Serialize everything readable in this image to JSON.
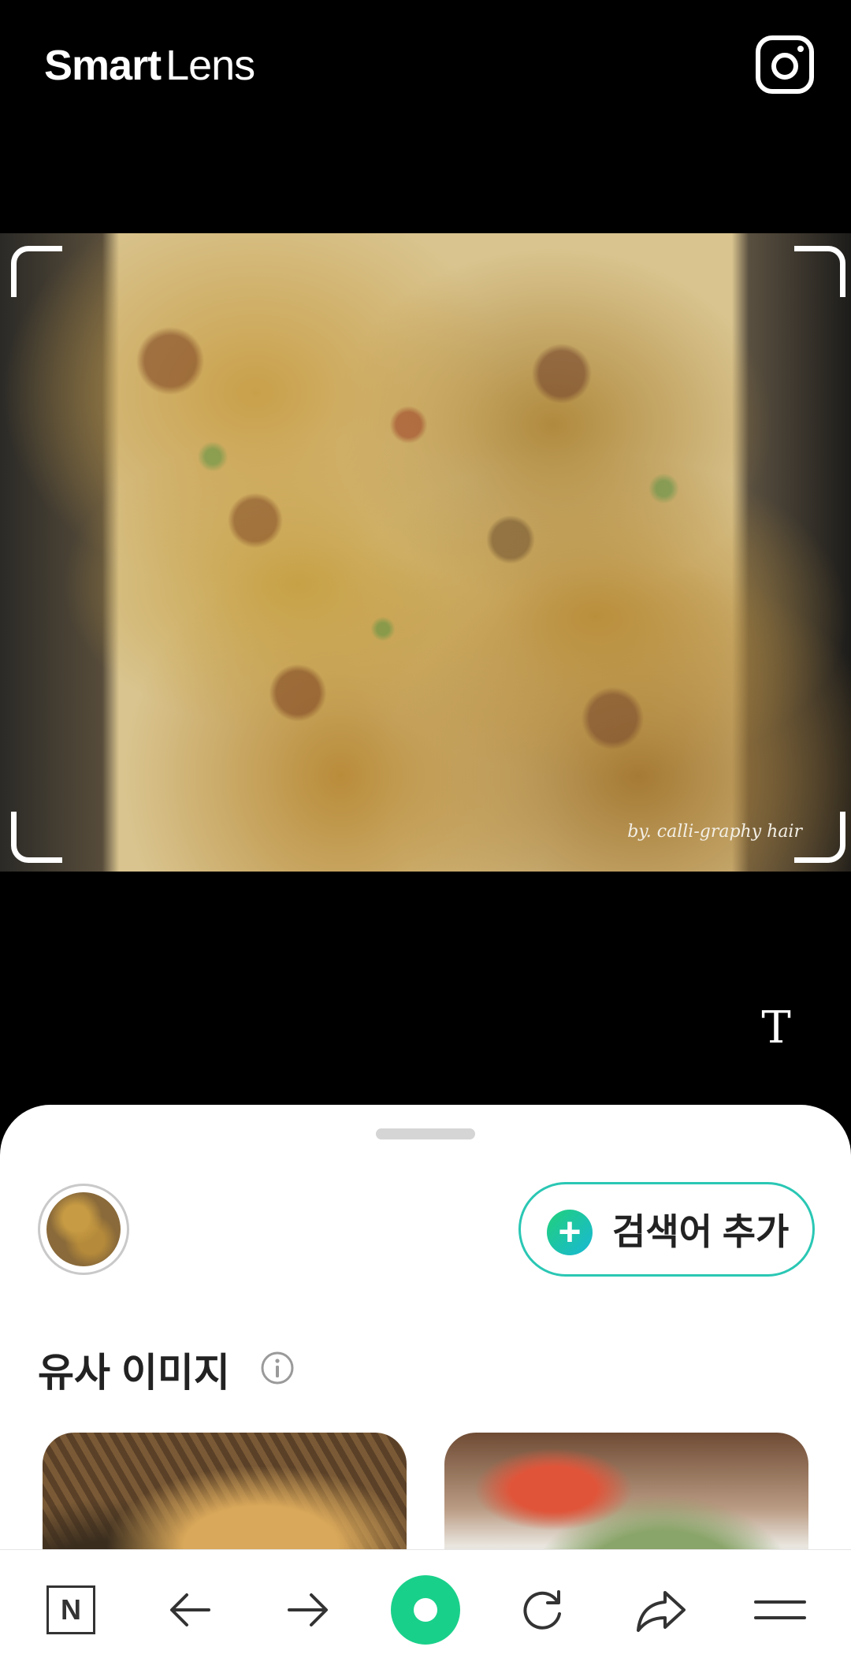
{
  "app": {
    "brand_bold": "Smart",
    "brand_light": "Lens"
  },
  "header": {
    "camera_icon": "camera-icon"
  },
  "photo": {
    "watermark": "by. calli-graphy hair"
  },
  "text_mode": {
    "label": "T"
  },
  "sheet": {
    "add_keyword_label": "검색어 추가",
    "add_icon_glyph": "+",
    "similar_images_title": "유사 이미지"
  },
  "navbar": {
    "home_glyph": "N",
    "items": [
      "home-n-icon",
      "back-arrow-icon",
      "forward-arrow-icon",
      "lens-search-button",
      "refresh-icon",
      "share-icon",
      "menu-icon"
    ]
  },
  "colors": {
    "accent": "#2ac7b4",
    "green": "#19d08a",
    "background": "#000000",
    "sheet": "#ffffff"
  }
}
